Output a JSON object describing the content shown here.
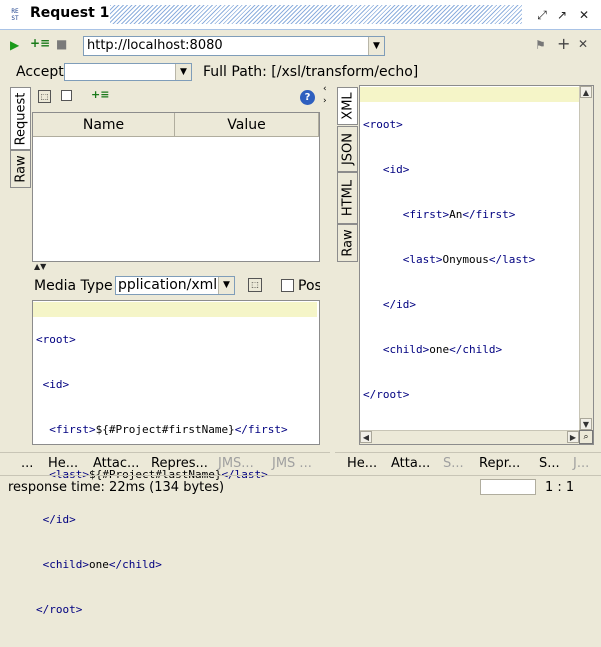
{
  "title_bar": {
    "logo_text": "RE ST",
    "title": "Request 1",
    "btn_detach": "⤢",
    "btn_max": "↗",
    "btn_close": "✕"
  },
  "toolbar": {
    "url": "http://localhost:8080",
    "play": "▶",
    "add": "+≡",
    "stop": "■",
    "right_add": "+",
    "right_close": "✕",
    "right_icon": "⚑"
  },
  "accept_row": {
    "accept_label": "Accept",
    "accept_value": "",
    "full_path": "Full Path: [/xsl/transform/echo]"
  },
  "request_panel": {
    "tabs": [
      "Request",
      "Raw"
    ],
    "table_headers": [
      "Name",
      "Value"
    ],
    "help_icon": "?",
    "media_type_label": "Media Type",
    "media_type_value": "pplication/xml",
    "post_label": "Pos",
    "body_lines": [
      [
        "<root>",
        ""
      ],
      [
        " <id>",
        ""
      ],
      [
        "  <first>",
        "${#Project#firstName}",
        "</first>"
      ],
      [
        "  <last>",
        "${#Project#lastName}",
        "</last>"
      ],
      [
        " </id>",
        ""
      ],
      [
        " <child>",
        "one",
        "</child>"
      ],
      [
        "</root>",
        ""
      ]
    ]
  },
  "response_panel": {
    "tabs": [
      "XML",
      "JSON",
      "HTML",
      "Raw"
    ],
    "body_lines": [
      [
        "<root>",
        ""
      ],
      [
        "   <id>",
        ""
      ],
      [
        "      <first>",
        "An",
        "</first>"
      ],
      [
        "      <last>",
        "Onymous",
        "</last>"
      ],
      [
        "   </id>",
        ""
      ],
      [
        "   <child>",
        "one",
        "</child>"
      ],
      [
        "</root>",
        ""
      ]
    ]
  },
  "bottom_tabs_left": [
    {
      "label": "...",
      "disabled": false
    },
    {
      "label": "He...",
      "disabled": false
    },
    {
      "label": "Attac...",
      "disabled": false
    },
    {
      "label": "Repres...",
      "disabled": false
    },
    {
      "label": "JMS...",
      "disabled": true
    },
    {
      "label": "JMS ...",
      "disabled": true
    }
  ],
  "bottom_tabs_right": [
    {
      "label": "He...",
      "disabled": false
    },
    {
      "label": "Atta...",
      "disabled": false
    },
    {
      "label": "S...",
      "disabled": true
    },
    {
      "label": "Repr...",
      "disabled": false
    },
    {
      "label": "S...",
      "disabled": false
    },
    {
      "label": "J...",
      "disabled": true
    }
  ],
  "status": {
    "response_time": "response time: 22ms (134 bytes)",
    "position": "1 : 1"
  },
  "colors": {
    "tag": "#000080",
    "highlight": "#f5f5c8",
    "hatch": "#8fb0de"
  }
}
